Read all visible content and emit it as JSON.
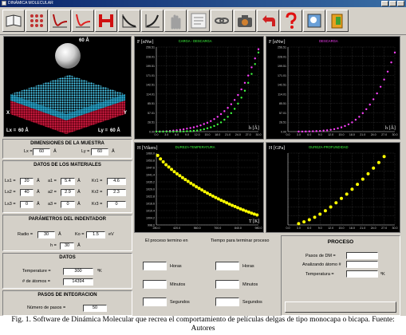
{
  "window": {
    "title": "DINÁMICA MOLECULAR"
  },
  "toolbar": {
    "buttons": [
      {
        "icon": "open-book-icon"
      },
      {
        "icon": "lattice-icon"
      },
      {
        "icon": "potential-curve-icon"
      },
      {
        "icon": "potential-curve-red-icon"
      },
      {
        "icon": "hardness-h-icon"
      },
      {
        "icon": "load-curve-icon"
      },
      {
        "icon": "unload-curve-icon"
      },
      {
        "icon": "hand-icon"
      },
      {
        "icon": "lines-icon"
      },
      {
        "icon": "chain-icon"
      },
      {
        "icon": "camera-icon"
      },
      {
        "icon": "back-arrow-icon"
      },
      {
        "icon": "help-icon"
      },
      {
        "icon": "image-icon"
      },
      {
        "icon": "exit-door-icon"
      }
    ]
  },
  "sample_view": {
    "top_label": "60 Å",
    "axis_x": "X",
    "axis_y": "Y",
    "lx_label": "Lx =",
    "lx_value": "60 Å",
    "ly_label": "Ly =",
    "ly_value": "60 Å",
    "colors": {
      "film_top": "#4fd8ff",
      "film_bottom": "#e0204a",
      "indenter": "#d8d8d8"
    }
  },
  "sample_dims": {
    "title": "DIMENSIONES DE LA MUESTRA",
    "lx_label": "Lx =",
    "lx_value": "60",
    "lx_unit": "Å",
    "ly_label": "Ly =",
    "ly_value": "60",
    "ly_unit": "Å"
  },
  "materials": {
    "title": "DATOS DE LOS MATERIALES",
    "rows": [
      {
        "ls": "Ls1 =",
        "lsv": "20",
        "lsu": "Å",
        "a": "a1 =",
        "av": "5.4",
        "au": "Å",
        "kr": "Kr1 =",
        "krv": "4.6"
      },
      {
        "ls": "Ls2 =",
        "lsv": "40",
        "lsu": "Å",
        "a": "a2 =",
        "av": "2.9",
        "au": "Å",
        "kr": "Kr2 =",
        "krv": "2.3"
      },
      {
        "ls": "Ls3 =",
        "lsv": "0",
        "lsu": "Å",
        "a": "a3 =",
        "av": "0",
        "au": "Å",
        "kr": "Kr3 =",
        "krv": "0"
      }
    ]
  },
  "indenter": {
    "title": "PARÁMETROS DEL INDENTADOR",
    "radio_label": "Radio =",
    "radio_value": "30",
    "radio_unit": "Å",
    "ko_label": "Ko =",
    "ko_value": "1.5",
    "ko_unit": "eV",
    "h_label": "h =",
    "h_value": "30",
    "h_unit": "Å"
  },
  "datos": {
    "title": "DATOS",
    "temp_label": "Temperature =",
    "temp_value": "300",
    "temp_unit": "ºK",
    "atoms_label": "# de átomos =",
    "atoms_value": "14394"
  },
  "pasos": {
    "title": "PASOS DE INTEGRACION",
    "num_label": "Número de pasos =",
    "num_value": "50"
  },
  "charts": {
    "load": {
      "ylabel": "F [nNw]",
      "title": "CARGA - DESCARGA",
      "xlabel": "h [Å]",
      "color_load": "#ff40ff",
      "color_unload": "#40ff40"
    },
    "unload": {
      "ylabel": "F [nNw]",
      "title": "DESCARGA",
      "xlabel": "h [Å]",
      "color": "#ff40ff"
    },
    "vickers": {
      "ylabel": "H [Vikers]",
      "title": "DUREZA-TEMPERATURA",
      "xlabel": "T [K]",
      "color": "#ffff00"
    },
    "gpa": {
      "ylabel": "H [GPa]",
      "title": "DUREZA-PROFUNDIDAD",
      "color": "#ffff00"
    }
  },
  "chart_data": [
    {
      "type": "scatter",
      "title": "CARGA - DESCARGA",
      "ylabel": "F [nNw]",
      "xlabel": "h [Å]",
      "y_ticks": [
        "256.51",
        "228.01",
        "199.51",
        "171.01",
        "142.51",
        "114.01",
        "85.51",
        "57.01",
        "28.51",
        "0.00"
      ],
      "x_ticks": [
        "0.0",
        "3.0",
        "6.0",
        "9.0",
        "12.0",
        "15.0",
        "18.0",
        "21.0",
        "24.0",
        "27.0",
        "30.0"
      ],
      "xlim": [
        0,
        30
      ],
      "ylim": [
        0,
        256.51
      ],
      "series": [
        {
          "name": "CARGA",
          "x": [
            0,
            1,
            2,
            3,
            4,
            5,
            6,
            7,
            8,
            9,
            10,
            11,
            12,
            13,
            14,
            15,
            16,
            17,
            18,
            19,
            20,
            21,
            22,
            23,
            24,
            25,
            26,
            27,
            28,
            29,
            30
          ],
          "y": [
            0,
            0,
            0.5,
            1,
            2,
            3,
            4,
            5.5,
            7,
            9,
            11,
            13,
            16,
            19,
            23,
            27,
            32,
            38,
            45,
            53,
            62,
            72,
            83,
            96,
            111,
            128,
            148,
            170,
            195,
            222,
            250
          ]
        },
        {
          "name": "DESCARGA",
          "x": [
            30,
            29,
            28,
            27,
            26,
            25,
            24,
            23,
            22,
            21,
            20,
            19,
            18,
            17,
            16,
            15,
            14,
            13,
            12,
            11,
            10,
            9,
            8,
            7,
            6,
            5,
            4,
            3,
            2,
            1,
            0
          ],
          "y": [
            240,
            205,
            175,
            148,
            124,
            103,
            85,
            69,
            56,
            45,
            36,
            28,
            22,
            17,
            13,
            10,
            7,
            5,
            3.5,
            2.5,
            1.5,
            1,
            0.5,
            0.3,
            0.1,
            0,
            0,
            0,
            0,
            0,
            0
          ]
        }
      ]
    },
    {
      "type": "scatter",
      "title": "DESCARGA",
      "ylabel": "F [nNw]",
      "xlabel": "h [Å]",
      "y_ticks": [
        "256.51",
        "228.01",
        "199.51",
        "171.01",
        "142.51",
        "114.01",
        "85.51",
        "57.01",
        "28.51",
        "0.00"
      ],
      "x_ticks": [
        "0.0",
        "3.0",
        "6.0",
        "9.0",
        "12.0",
        "15.0",
        "18.0",
        "21.0",
        "24.0",
        "27.0",
        "30.0"
      ],
      "xlim": [
        0,
        30
      ],
      "ylim": [
        0,
        256.51
      ],
      "series": [
        {
          "name": "DESCARGA",
          "x": [
            30,
            29,
            28,
            27,
            26,
            25,
            24,
            23,
            22,
            21,
            20,
            19,
            18,
            17,
            16,
            15,
            14,
            13,
            12,
            11,
            10,
            9,
            8,
            7,
            6,
            5,
            4,
            3
          ],
          "y": [
            240,
            210,
            182,
            158,
            136,
            116,
            98,
            82,
            68,
            56,
            45,
            36,
            28,
            22,
            17,
            13,
            10,
            7.5,
            5.5,
            4,
            3,
            2,
            1.5,
            1,
            0.6,
            0.3,
            0.1,
            0
          ]
        }
      ]
    },
    {
      "type": "scatter",
      "title": "DUREZA-TEMPERATURA",
      "ylabel": "H [Vikers]",
      "xlabel": "T [K]",
      "y_ticks": [
        "1060.0",
        "1053.8",
        "1047.6",
        "1041.4",
        "1035.2",
        "1029.0",
        "1022.8",
        "1016.6",
        "1010.4",
        "1004.2",
        "998.0"
      ],
      "x_ticks": [
        "280.0",
        "420.0",
        "560.0",
        "700.0",
        "840.0",
        "980.0"
      ],
      "ylim": [
        998.0,
        1060.0
      ],
      "series": [
        {
          "name": "H",
          "x": [
            290,
            310,
            330,
            350,
            370,
            390,
            410,
            430,
            450,
            470,
            490,
            510,
            530,
            550,
            570,
            590,
            610,
            630,
            650,
            670,
            690,
            710,
            730,
            750,
            770,
            790,
            810,
            830,
            850,
            870,
            890,
            910,
            930,
            950,
            970,
            990,
            1010
          ],
          "y": [
            1058,
            1055,
            1052.5,
            1050,
            1048,
            1046,
            1044,
            1042.2,
            1040.5,
            1038.8,
            1037.2,
            1035.6,
            1034,
            1032.5,
            1031,
            1029.6,
            1028.2,
            1026.8,
            1025.5,
            1024.2,
            1022.9,
            1021.7,
            1020.5,
            1019.3,
            1018.2,
            1017.1,
            1016,
            1014.9,
            1013.9,
            1012.9,
            1011.9,
            1010.9,
            1010,
            1009.1,
            1008.2,
            1007.4,
            1006.6
          ]
        }
      ]
    },
    {
      "type": "scatter",
      "title": "DUREZA-PROFUNDIDAD",
      "ylabel": "H [GPa]",
      "x_ticks": [
        "0.0",
        "3.0",
        "6.0",
        "9.0",
        "12.0",
        "15.0",
        "18.0",
        "21.0",
        "24.0",
        "27.0",
        "30.0"
      ],
      "xlim": [
        0,
        30
      ],
      "series": [
        {
          "name": "H",
          "x": [
            3,
            4.5,
            6,
            7.5,
            9,
            10.5,
            12,
            13.5,
            15,
            16.5,
            18,
            19.5,
            21,
            22.5,
            24,
            25.5,
            27
          ],
          "y": [
            0.5,
            1.2,
            2.0,
            3.0,
            4.2,
            5.5,
            7.0,
            8.6,
            10.3,
            12.0,
            13.9,
            15.8,
            17.8,
            19.9,
            22.1,
            24.3,
            26.6
          ]
        }
      ]
    }
  ],
  "time_panel": {
    "ended_label": "El proceso termino en",
    "remaining_label": "Tiempo para terminar proceso",
    "horas": "Horas",
    "minutos": "Minutos",
    "segundos": "Segundos"
  },
  "proceso": {
    "title": "PROCESO",
    "pasos_label": "Pasos de DM =",
    "analizando_label": "Analizando átomo #",
    "temp_label": "Temperatura =",
    "temp_unit": "ºK"
  },
  "caption": "Fig. 1. Software de Dinámica Molecular que recrea el comportamiento de películas delgas de tipo monocapa o bicapa. Fuente: Autores"
}
